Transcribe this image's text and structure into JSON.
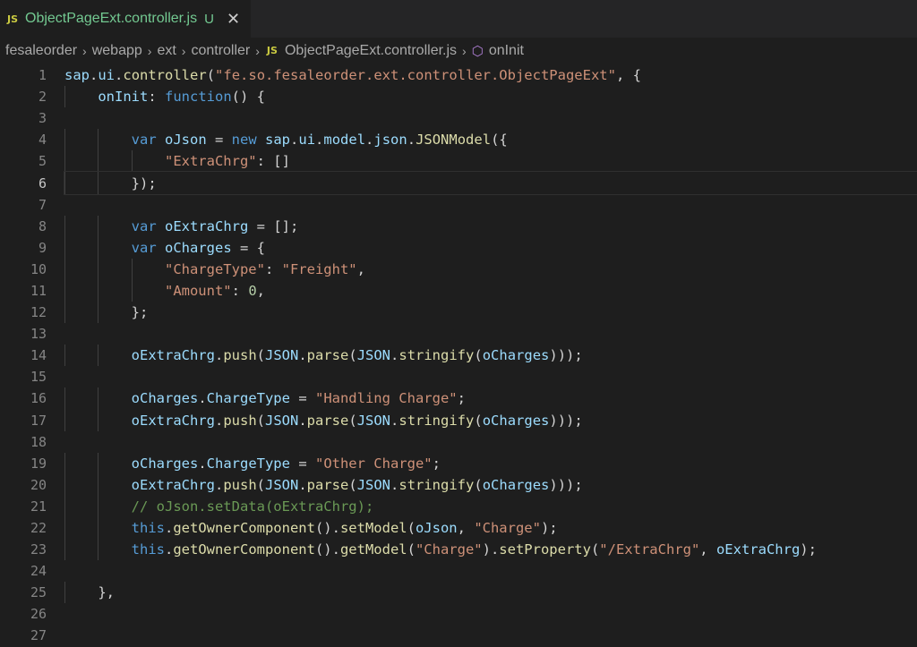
{
  "tab": {
    "icon_text": "JS",
    "title": "ObjectPageExt.controller.js",
    "status": "U",
    "close_glyph": "✕"
  },
  "breadcrumbs": {
    "items": [
      "fesaleorder",
      "webapp",
      "ext",
      "controller"
    ],
    "file_icon": "JS",
    "file": "ObjectPageExt.controller.js",
    "symbol": "onInit"
  },
  "editor": {
    "active_line": 6,
    "lines": [
      {
        "n": "1",
        "indent": 0,
        "tokens": [
          [
            "t-var",
            "sap"
          ],
          [
            "t-pl",
            "."
          ],
          [
            "t-var",
            "ui"
          ],
          [
            "t-pl",
            "."
          ],
          [
            "t-fn",
            "controller"
          ],
          [
            "t-pl",
            "("
          ],
          [
            "t-str",
            "\"fe.so.fesaleorder.ext.controller.ObjectPageExt\""
          ],
          [
            "t-pl",
            ", {"
          ]
        ]
      },
      {
        "n": "2",
        "indent": 1,
        "tokens": [
          [
            "t-var",
            "onInit"
          ],
          [
            "t-pl",
            ": "
          ],
          [
            "t-kw",
            "function"
          ],
          [
            "t-pl",
            "() {"
          ]
        ]
      },
      {
        "n": "3",
        "indent": 0,
        "tokens": []
      },
      {
        "n": "4",
        "indent": 2,
        "tokens": [
          [
            "t-kw",
            "var"
          ],
          [
            "t-pl",
            " "
          ],
          [
            "t-var",
            "oJson"
          ],
          [
            "t-pl",
            " = "
          ],
          [
            "t-kw",
            "new"
          ],
          [
            "t-pl",
            " "
          ],
          [
            "t-var",
            "sap"
          ],
          [
            "t-pl",
            "."
          ],
          [
            "t-var",
            "ui"
          ],
          [
            "t-pl",
            "."
          ],
          [
            "t-var",
            "model"
          ],
          [
            "t-pl",
            "."
          ],
          [
            "t-var",
            "json"
          ],
          [
            "t-pl",
            "."
          ],
          [
            "t-fn",
            "JSONModel"
          ],
          [
            "t-pl",
            "({"
          ]
        ]
      },
      {
        "n": "5",
        "indent": 3,
        "tokens": [
          [
            "t-str",
            "\"ExtraChrg\""
          ],
          [
            "t-pl",
            ": []"
          ]
        ]
      },
      {
        "n": "6",
        "indent": 2,
        "tokens": [
          [
            "t-pl",
            "});"
          ]
        ]
      },
      {
        "n": "7",
        "indent": 0,
        "tokens": []
      },
      {
        "n": "8",
        "indent": 2,
        "tokens": [
          [
            "t-kw",
            "var"
          ],
          [
            "t-pl",
            " "
          ],
          [
            "t-var",
            "oExtraChrg"
          ],
          [
            "t-pl",
            " = [];"
          ]
        ]
      },
      {
        "n": "9",
        "indent": 2,
        "tokens": [
          [
            "t-kw",
            "var"
          ],
          [
            "t-pl",
            " "
          ],
          [
            "t-var",
            "oCharges"
          ],
          [
            "t-pl",
            " = {"
          ]
        ]
      },
      {
        "n": "10",
        "indent": 3,
        "tokens": [
          [
            "t-str",
            "\"ChargeType\""
          ],
          [
            "t-pl",
            ": "
          ],
          [
            "t-str",
            "\"Freight\""
          ],
          [
            "t-pl",
            ","
          ]
        ]
      },
      {
        "n": "11",
        "indent": 3,
        "tokens": [
          [
            "t-str",
            "\"Amount\""
          ],
          [
            "t-pl",
            ": "
          ],
          [
            "t-num",
            "0"
          ],
          [
            "t-pl",
            ","
          ]
        ]
      },
      {
        "n": "12",
        "indent": 2,
        "tokens": [
          [
            "t-pl",
            "};"
          ]
        ]
      },
      {
        "n": "13",
        "indent": 0,
        "tokens": []
      },
      {
        "n": "14",
        "indent": 2,
        "tokens": [
          [
            "t-var",
            "oExtraChrg"
          ],
          [
            "t-pl",
            "."
          ],
          [
            "t-fn",
            "push"
          ],
          [
            "t-pl",
            "("
          ],
          [
            "t-var",
            "JSON"
          ],
          [
            "t-pl",
            "."
          ],
          [
            "t-fn",
            "parse"
          ],
          [
            "t-pl",
            "("
          ],
          [
            "t-var",
            "JSON"
          ],
          [
            "t-pl",
            "."
          ],
          [
            "t-fn",
            "stringify"
          ],
          [
            "t-pl",
            "("
          ],
          [
            "t-var",
            "oCharges"
          ],
          [
            "t-pl",
            ")));"
          ]
        ]
      },
      {
        "n": "15",
        "indent": 0,
        "tokens": []
      },
      {
        "n": "16",
        "indent": 2,
        "tokens": [
          [
            "t-var",
            "oCharges"
          ],
          [
            "t-pl",
            "."
          ],
          [
            "t-var",
            "ChargeType"
          ],
          [
            "t-pl",
            " = "
          ],
          [
            "t-str",
            "\"Handling Charge\""
          ],
          [
            "t-pl",
            ";"
          ]
        ]
      },
      {
        "n": "17",
        "indent": 2,
        "tokens": [
          [
            "t-var",
            "oExtraChrg"
          ],
          [
            "t-pl",
            "."
          ],
          [
            "t-fn",
            "push"
          ],
          [
            "t-pl",
            "("
          ],
          [
            "t-var",
            "JSON"
          ],
          [
            "t-pl",
            "."
          ],
          [
            "t-fn",
            "parse"
          ],
          [
            "t-pl",
            "("
          ],
          [
            "t-var",
            "JSON"
          ],
          [
            "t-pl",
            "."
          ],
          [
            "t-fn",
            "stringify"
          ],
          [
            "t-pl",
            "("
          ],
          [
            "t-var",
            "oCharges"
          ],
          [
            "t-pl",
            ")));"
          ]
        ]
      },
      {
        "n": "18",
        "indent": 0,
        "tokens": []
      },
      {
        "n": "19",
        "indent": 2,
        "tokens": [
          [
            "t-var",
            "oCharges"
          ],
          [
            "t-pl",
            "."
          ],
          [
            "t-var",
            "ChargeType"
          ],
          [
            "t-pl",
            " = "
          ],
          [
            "t-str",
            "\"Other Charge\""
          ],
          [
            "t-pl",
            ";"
          ]
        ]
      },
      {
        "n": "20",
        "indent": 2,
        "tokens": [
          [
            "t-var",
            "oExtraChrg"
          ],
          [
            "t-pl",
            "."
          ],
          [
            "t-fn",
            "push"
          ],
          [
            "t-pl",
            "("
          ],
          [
            "t-var",
            "JSON"
          ],
          [
            "t-pl",
            "."
          ],
          [
            "t-fn",
            "parse"
          ],
          [
            "t-pl",
            "("
          ],
          [
            "t-var",
            "JSON"
          ],
          [
            "t-pl",
            "."
          ],
          [
            "t-fn",
            "stringify"
          ],
          [
            "t-pl",
            "("
          ],
          [
            "t-var",
            "oCharges"
          ],
          [
            "t-pl",
            ")));"
          ]
        ]
      },
      {
        "n": "21",
        "indent": 2,
        "tokens": [
          [
            "t-com",
            "// oJson.setData(oExtraChrg);"
          ]
        ]
      },
      {
        "n": "22",
        "indent": 2,
        "tokens": [
          [
            "t-kw",
            "this"
          ],
          [
            "t-pl",
            "."
          ],
          [
            "t-fn",
            "getOwnerComponent"
          ],
          [
            "t-pl",
            "()."
          ],
          [
            "t-fn",
            "setModel"
          ],
          [
            "t-pl",
            "("
          ],
          [
            "t-var",
            "oJson"
          ],
          [
            "t-pl",
            ", "
          ],
          [
            "t-str",
            "\"Charge\""
          ],
          [
            "t-pl",
            ");"
          ]
        ]
      },
      {
        "n": "23",
        "indent": 2,
        "tokens": [
          [
            "t-kw",
            "this"
          ],
          [
            "t-pl",
            "."
          ],
          [
            "t-fn",
            "getOwnerComponent"
          ],
          [
            "t-pl",
            "()."
          ],
          [
            "t-fn",
            "getModel"
          ],
          [
            "t-pl",
            "("
          ],
          [
            "t-str",
            "\"Charge\""
          ],
          [
            "t-pl",
            ")."
          ],
          [
            "t-fn",
            "setProperty"
          ],
          [
            "t-pl",
            "("
          ],
          [
            "t-str",
            "\"/ExtraChrg\""
          ],
          [
            "t-pl",
            ", "
          ],
          [
            "t-var",
            "oExtraChrg"
          ],
          [
            "t-pl",
            ");"
          ]
        ]
      },
      {
        "n": "24",
        "indent": 0,
        "tokens": []
      },
      {
        "n": "25",
        "indent": 1,
        "tokens": [
          [
            "t-pl",
            "},"
          ]
        ]
      },
      {
        "n": "26",
        "indent": 0,
        "tokens": []
      },
      {
        "n": "27",
        "indent": 0,
        "tokens": []
      }
    ]
  },
  "colors": {
    "background": "#1e1e1e",
    "tab_title": "#73c991",
    "keyword": "#569cd6",
    "variable": "#9cdcfe",
    "function": "#dcdcaa",
    "string": "#ce9178",
    "comment": "#6a9955"
  }
}
